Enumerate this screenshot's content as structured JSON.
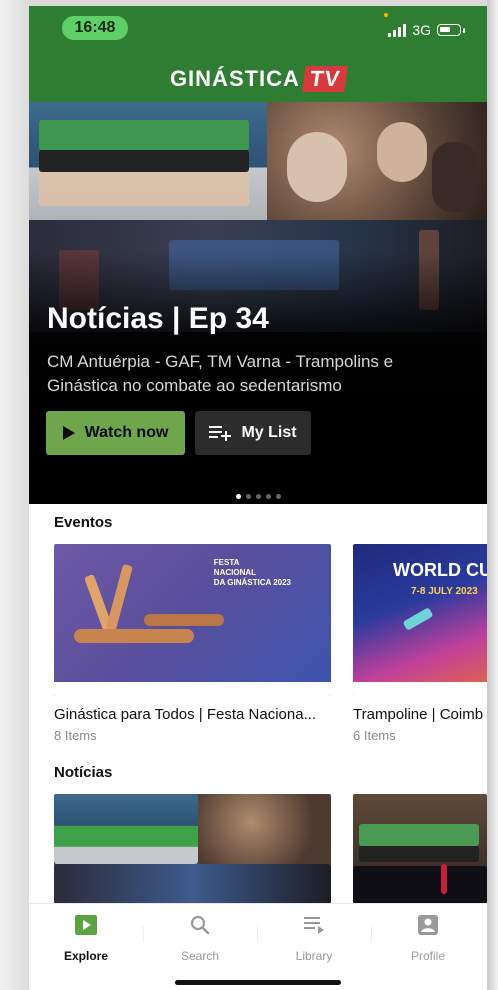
{
  "status_bar": {
    "time": "16:48",
    "network": "3G"
  },
  "header": {
    "logo_text": "GINÁSTICA",
    "logo_badge": "TV"
  },
  "hero": {
    "title": "Notícias | Ep 34",
    "subtitle": "CM Antuérpia - GAF, TM Varna - Trampolins e Ginástica no combate ao sedentarismo",
    "watch_label": "Watch now",
    "list_label": "My List",
    "carousel_dots": 5,
    "active_dot": 0
  },
  "sections": {
    "eventos": {
      "title": "Eventos",
      "cards": [
        {
          "title": "Ginástica para Todos | Festa Naciona...",
          "count": "8 Items",
          "thumb_lines": [
            "FESTA",
            "NACIONAL",
            "DA GINÁSTICA 2023"
          ]
        },
        {
          "title": "Trampoline | Coimb",
          "count": "6 Items",
          "thumb_lines": [
            "WORLD CU",
            "7-8 JULY 2023"
          ]
        }
      ]
    },
    "noticias": {
      "title": "Notícias"
    }
  },
  "tabbar": {
    "tabs": [
      {
        "label": "Explore",
        "icon": "play-square-icon",
        "active": true
      },
      {
        "label": "Search",
        "icon": "search-icon",
        "active": false
      },
      {
        "label": "Library",
        "icon": "library-icon",
        "active": false
      },
      {
        "label": "Profile",
        "icon": "profile-icon",
        "active": false
      }
    ]
  },
  "colors": {
    "brand_green": "#2f7d32",
    "accent_green": "#6fa64c",
    "badge_red": "#d9393c"
  }
}
